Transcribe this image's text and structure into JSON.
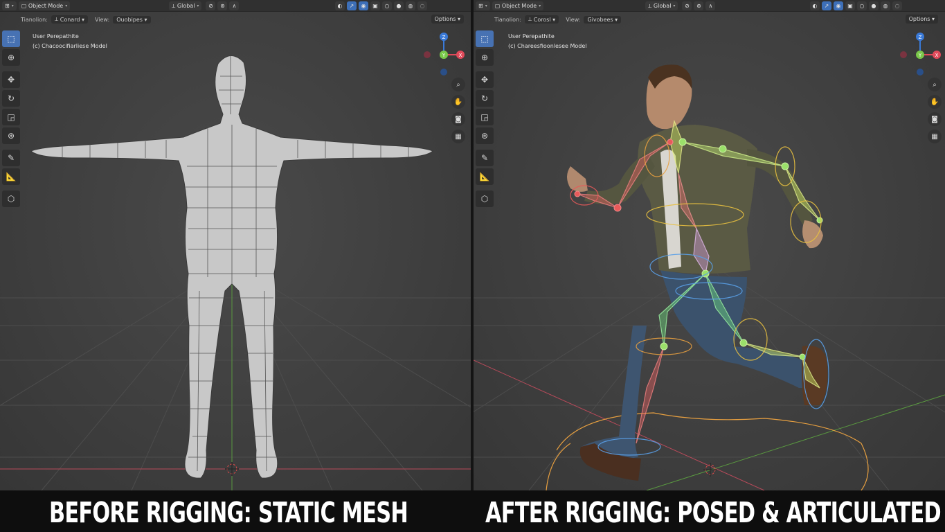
{
  "left_viewport": {
    "header": {
      "mode": "Object Mode",
      "transform_orientation": "Global"
    },
    "toolsettings": {
      "orientation_label": "Tianolion:",
      "orientation_value": "Conard",
      "view_label": "View:",
      "view_value": "Ouobipes",
      "options_label": "Options"
    },
    "view_info": {
      "line1": "User Perepathite",
      "line2": "(c) Chacoocifiarliese Model"
    }
  },
  "right_viewport": {
    "header": {
      "mode": "Object Mode",
      "transform_orientation": "Global"
    },
    "toolsettings": {
      "orientation_label": "Tianolion:",
      "orientation_value": "Corosl",
      "view_label": "View:",
      "view_value": "Givobees",
      "options_label": "Options"
    },
    "view_info": {
      "line1": "User Perepathite",
      "line2": "(c) Chareesfioonlesee Model"
    }
  },
  "gizmo_axes": {
    "x": "X",
    "y": "Y",
    "z": "Z"
  },
  "captions": {
    "left": "BEFORE RIGGING: STATIC MESH",
    "right": "AFTER RIGGING: POSED & ARTICULATED"
  },
  "colors": {
    "viewport_bg": "#404040",
    "header_bg": "#303030",
    "active_tool": "#4772b3",
    "axis_x": "#e04a5a",
    "axis_y": "#7ac84a",
    "axis_z": "#3a7ad8",
    "bone_red": "#e85a5a",
    "bone_green": "#9be06a",
    "bone_yellow": "#e8e070",
    "ik_circle": "#e8a040"
  }
}
